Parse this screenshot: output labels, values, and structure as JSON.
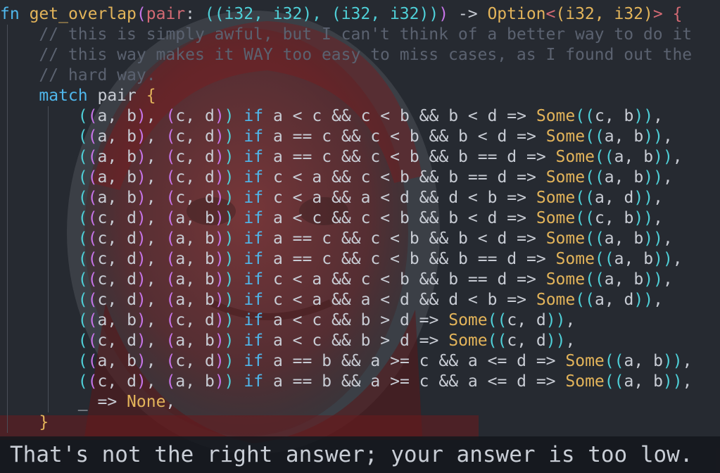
{
  "editor": {
    "signature": {
      "fn_kw": "fn",
      "name": "get_overlap",
      "param": "pair",
      "colon": ": ",
      "param_type": "((i32, i32), (i32, i32))",
      "arrow": " -> ",
      "ret_option": "Option",
      "ret_lt": "<",
      "ret_inner": "(i32, i32)",
      "ret_gt": ">",
      "brace": " {"
    },
    "comments": [
      "// this is simply awful, but I can't think of a better way to do it",
      "// this way makes it WAY too easy to miss cases, as I found out the",
      "// hard way."
    ],
    "match_kw": "match",
    "match_subject": " pair ",
    "match_brace": "{",
    "arms": [
      {
        "pat": "((a, b), (c, d))",
        "cond": "a < c && c < b && b < d",
        "res": "(c, b)"
      },
      {
        "pat": "((a, b), (c, d))",
        "cond": "a == c && c < b && b < d",
        "res": "(a, b)"
      },
      {
        "pat": "((a, b), (c, d))",
        "cond": "a == c && c < b && b == d",
        "res": "(a, b)"
      },
      {
        "pat": "((a, b), (c, d))",
        "cond": "c < a && c < b && b == d",
        "res": "(a, b)"
      },
      {
        "pat": "((a, b), (c, d))",
        "cond": "c < a && a < d && d < b",
        "res": "(a, d)"
      },
      {
        "pat": "((c, d), (a, b))",
        "cond": "a < c && c < b && b < d",
        "res": "(c, b)"
      },
      {
        "pat": "((c, d), (a, b))",
        "cond": "a == c && c < b && b < d",
        "res": "(a, b)"
      },
      {
        "pat": "((c, d), (a, b))",
        "cond": "a == c && c < b && b == d",
        "res": "(a, b)"
      },
      {
        "pat": "((c, d), (a, b))",
        "cond": "c < a && c < b && b == d",
        "res": "(a, b)"
      },
      {
        "pat": "((c, d), (a, b))",
        "cond": "c < a && a < d && d < b",
        "res": "(a, d)"
      },
      {
        "pat": "((a, b), (c, d))",
        "cond": "a < c && b > d",
        "res": "(c, d)"
      },
      {
        "pat": "((c, d), (a, b))",
        "cond": "a < c && b > d",
        "res": "(c, d)"
      },
      {
        "pat": "((a, b), (c, d))",
        "cond": "a == b && a >= c && a <= d",
        "res": "(a, b)"
      },
      {
        "pat": "((c, d), (a, b))",
        "cond": "a == b && a >= c && a <= d",
        "res": "(a, b)"
      }
    ],
    "if_kw": "if",
    "arrow_op": " => ",
    "some_kw": "Some",
    "wildcard": "_",
    "none_kw": "None",
    "arm_comma": ",",
    "close_brace": "}"
  },
  "status": {
    "message": "That's not the right answer; your answer is too low."
  },
  "colors": {
    "background": "#262a31",
    "keyword": "#4fb7ec",
    "function_name": "#e3b45a",
    "comment": "#5b6270",
    "bracket_outer": "#c774e8",
    "bracket_inner": "#4fd0d8",
    "portrait_red": "#8a1f22"
  }
}
